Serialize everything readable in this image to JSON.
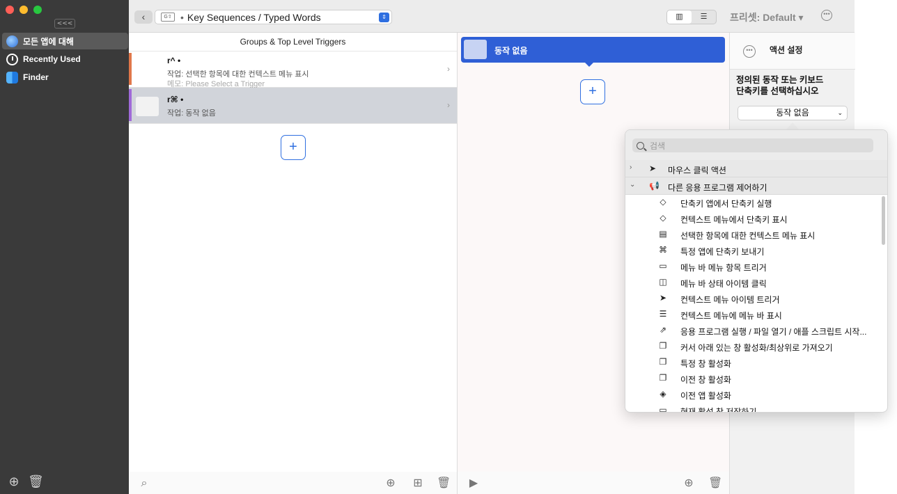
{
  "sidebar": {
    "collapse_label": "<<<",
    "apps": [
      {
        "label": "모든 앱에 대해",
        "icon": "globe-icon"
      },
      {
        "label": "Recently Used",
        "icon": "clock-icon"
      },
      {
        "label": "Finder",
        "icon": "finder-icon"
      }
    ]
  },
  "toolbar": {
    "trigger_type": "Key Sequences / Typed Words",
    "trigger_type_icon_text": "G⇧",
    "preset_label": "프리셋: Default ▾",
    "view_toggle": [
      "▥",
      "☰"
    ]
  },
  "triggers": {
    "header": "Groups & Top Level Triggers",
    "rows": [
      {
        "title": "r^ •",
        "action": "작업: 선택한 항목에 대한 컨텍스트 메뉴 표시",
        "memo": "메모: Please Select a Trigger",
        "accent": "#e0774a"
      },
      {
        "title": "r⌘ •",
        "action": "작업: 동작 없음",
        "memo": "",
        "accent": "#a06ad8"
      }
    ],
    "add_label": "+"
  },
  "action": {
    "selected_label": "동작 없음",
    "add_label": "+"
  },
  "config": {
    "title": "액션 설정",
    "heading_line1": "정의된 동작 또는 키보드",
    "heading_line2": "단축키를 선택하십시오",
    "selected_action": "동작 없음"
  },
  "popover": {
    "search_placeholder": "검색",
    "categories": [
      {
        "label": "마우스 클릭 액션",
        "expanded": false,
        "icon": "cursor-icon"
      },
      {
        "label": "다른 응용 프로그램 제어하기",
        "expanded": true,
        "icon": "megaphone-icon"
      }
    ],
    "items": [
      {
        "label": "단축키 앱에서 단축키 실행",
        "icon": "layers-icon"
      },
      {
        "label": "컨텍스트 메뉴에서 단축키 표시",
        "icon": "layers-icon"
      },
      {
        "label": "선택한 항목에 대한 컨텍스트 메뉴 표시",
        "icon": "context-menu-icon"
      },
      {
        "label": "특정 앱에 단축키 보내기",
        "icon": "command-icon"
      },
      {
        "label": "메뉴 바 메뉴 항목 트리거",
        "icon": "edit-menu-icon"
      },
      {
        "label": "메뉴 바 상태 아이템 클릭",
        "icon": "status-item-icon"
      },
      {
        "label": "컨텍스트 메뉴 아이템 트리거",
        "icon": "cursor-menu-icon"
      },
      {
        "label": "컨텍스트 메뉴에 메뉴 바 표시",
        "icon": "lines-icon"
      },
      {
        "label": "응용 프로그램 실행 / 파일 열기 / 애플 스크립트 시작...",
        "icon": "share-icon"
      },
      {
        "label": "커서 아래 있는 창 활성화/최상위로 가져오기",
        "icon": "windows-icon"
      },
      {
        "label": "특정 창 활성화",
        "icon": "windows-icon"
      },
      {
        "label": "이전 창 활성화",
        "icon": "windows-icon"
      },
      {
        "label": "이전 앱 활성화",
        "icon": "stack-icon"
      },
      {
        "label": "현재 활성 창 저장하기",
        "icon": "window-icon"
      }
    ]
  }
}
